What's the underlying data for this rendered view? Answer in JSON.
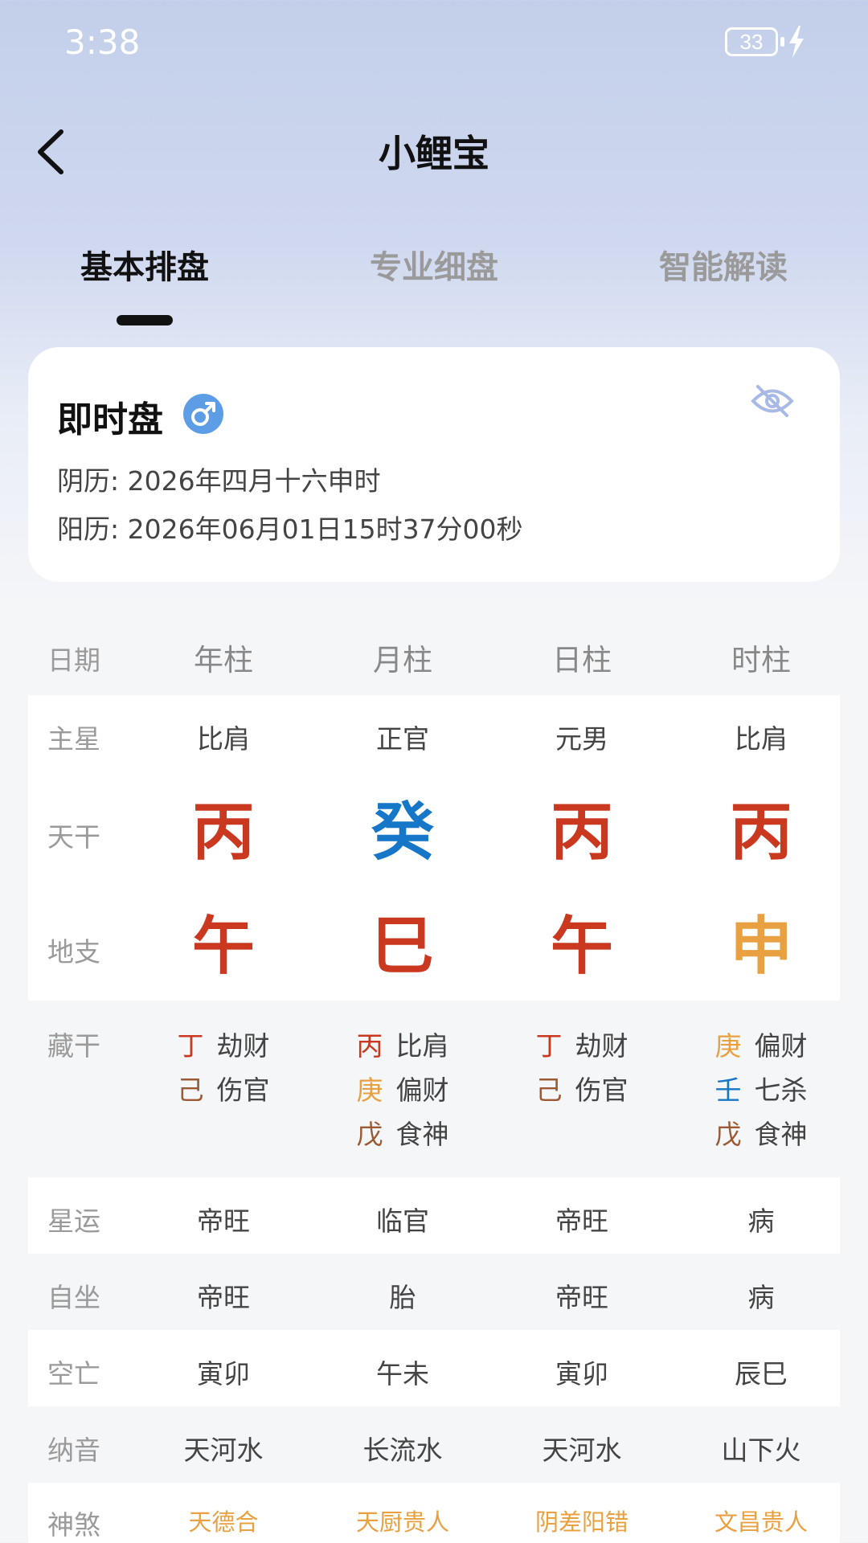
{
  "status_bar": {
    "time": "3:38",
    "battery": "33"
  },
  "nav": {
    "title": "小鲤宝"
  },
  "tabs": [
    {
      "label": "基本排盘",
      "active": true
    },
    {
      "label": "专业细盘",
      "active": false
    },
    {
      "label": "智能解读",
      "active": false
    }
  ],
  "card": {
    "title": "即时盘",
    "gender_icon": "male-symbol-icon",
    "lunar": "阴历: 2026年四月十六申时",
    "solar": "阳历: 2026年06月01日15时37分00秒"
  },
  "colors": {
    "fire_red": "#c9381f",
    "water_blue": "#1677c8",
    "metal_orange": "#e8a040",
    "earth_brown": "#9b5a32"
  },
  "table": {
    "header": {
      "label": "日期",
      "cols": [
        "年柱",
        "月柱",
        "日柱",
        "时柱"
      ]
    },
    "main_star": {
      "label": "主星",
      "values": [
        "比肩",
        "正官",
        "元男",
        "比肩"
      ]
    },
    "heavenly_stem": {
      "label": "天干",
      "values": [
        "丙",
        "癸",
        "丙",
        "丙"
      ]
    },
    "earthly_branch": {
      "label": "地支",
      "values": [
        "午",
        "巳",
        "午",
        "申"
      ]
    },
    "hidden_stems": {
      "label": "藏干",
      "cols": [
        [
          {
            "stem": "丁",
            "god": "劫财"
          },
          {
            "stem": "己",
            "god": "伤官"
          }
        ],
        [
          {
            "stem": "丙",
            "god": "比肩"
          },
          {
            "stem": "庚",
            "god": "偏财"
          },
          {
            "stem": "戊",
            "god": "食神"
          }
        ],
        [
          {
            "stem": "丁",
            "god": "劫财"
          },
          {
            "stem": "己",
            "god": "伤官"
          }
        ],
        [
          {
            "stem": "庚",
            "god": "偏财"
          },
          {
            "stem": "壬",
            "god": "七杀"
          },
          {
            "stem": "戊",
            "god": "食神"
          }
        ]
      ]
    },
    "star_fortune": {
      "label": "星运",
      "values": [
        "帝旺",
        "临官",
        "帝旺",
        "病"
      ]
    },
    "self_sit": {
      "label": "自坐",
      "values": [
        "帝旺",
        "胎",
        "帝旺",
        "病"
      ]
    },
    "void": {
      "label": "空亡",
      "values": [
        "寅卯",
        "午未",
        "寅卯",
        "辰巳"
      ]
    },
    "nayin": {
      "label": "纳音",
      "values": [
        "天河水",
        "长流水",
        "天河水",
        "山下火"
      ]
    },
    "shensha": {
      "label": "神煞",
      "values": [
        "天德合",
        "天厨贵人",
        "阴差阳错",
        "文昌贵人"
      ]
    }
  }
}
